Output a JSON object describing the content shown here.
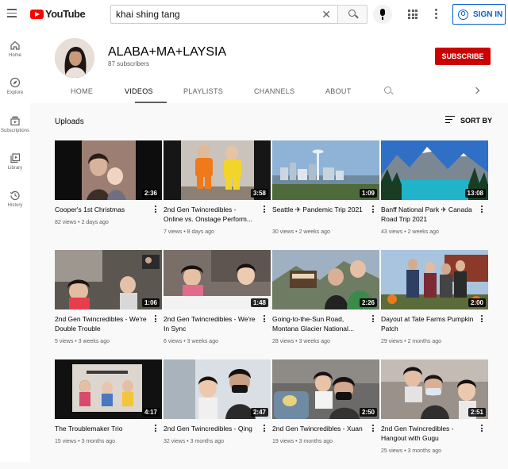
{
  "topbar": {
    "logo_text": "YouTube",
    "search_value": "khai shing tang",
    "sign_in_label": "SIGN IN"
  },
  "sidebar": {
    "items": [
      {
        "label": "Home",
        "icon": "home-icon"
      },
      {
        "label": "Explore",
        "icon": "compass-icon"
      },
      {
        "label": "Subscriptions",
        "icon": "subscriptions-icon"
      },
      {
        "label": "Library",
        "icon": "library-icon"
      },
      {
        "label": "History",
        "icon": "history-icon"
      }
    ]
  },
  "channel": {
    "name": "ALABA+MA+LAYSIA",
    "subscribers": "87 subscribers",
    "subscribe_label": "SUBSCRIBE"
  },
  "tabs": [
    "HOME",
    "VIDEOS",
    "PLAYLISTS",
    "CHANNELS",
    "ABOUT"
  ],
  "section": {
    "title": "Uploads",
    "sort_label": "SORT BY"
  },
  "videos": [
    {
      "title": "Cooper's 1st Christmas",
      "meta": "82 views • 2 days ago",
      "duration": "2:36"
    },
    {
      "title": "2nd Gen Twincredibles - Online vs. Onstage Perform...",
      "meta": "7 views • 8 days ago",
      "duration": "3:58"
    },
    {
      "title": "Seattle ✈ Pandemic Trip 2021",
      "meta": "30 views • 2 weeks ago",
      "duration": "1:09"
    },
    {
      "title": "Banff National Park ✈ Canada Road Trip 2021",
      "meta": "43 views • 2 weeks ago",
      "duration": "13:08"
    },
    {
      "title": "2nd Gen Twincredibles - We're Double Trouble",
      "meta": "5 views • 3 weeks ago",
      "duration": "1:06"
    },
    {
      "title": "2nd Gen Twincredibles - We're In Sync",
      "meta": "6 views • 3 weeks ago",
      "duration": "1:48"
    },
    {
      "title": "Going-to-the-Sun Road, Montana Glacier National...",
      "meta": "28 views • 3 weeks ago",
      "duration": "2:26"
    },
    {
      "title": "Dayout at Tate Farms Pumpkin Patch",
      "meta": "29 views • 2 months ago",
      "duration": "2:00"
    },
    {
      "title": "The Troublemaker Trio",
      "meta": "15 views • 3 months ago",
      "duration": "4:17"
    },
    {
      "title": "2nd Gen Twincredibles - Qing",
      "meta": "32 views • 3 months ago",
      "duration": "2:47"
    },
    {
      "title": "2nd Gen Twincredibles - Xuan",
      "meta": "19 views • 3 months ago",
      "duration": "2:50"
    },
    {
      "title": "2nd Gen Twincredibles - Hangout with Gugu",
      "meta": "25 views • 3 months ago",
      "duration": "2:51"
    }
  ],
  "colors": {
    "brand_red": "#ff0000",
    "subscribe_red": "#cc0000",
    "link_blue": "#065fd4"
  }
}
